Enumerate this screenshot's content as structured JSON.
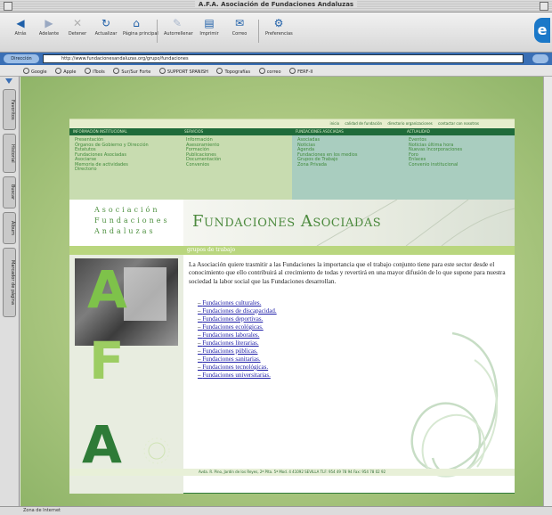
{
  "window": {
    "title": "A.F.A. Asociación de Fundaciones Andaluzas"
  },
  "toolbar": {
    "buttons": [
      {
        "label": "Atrás",
        "icon": "back-arrow-icon"
      },
      {
        "label": "Adelante",
        "icon": "forward-arrow-icon"
      },
      {
        "label": "Detener",
        "icon": "stop-icon"
      },
      {
        "label": "Actualizar",
        "icon": "refresh-icon"
      },
      {
        "label": "Página principal",
        "icon": "home-icon"
      },
      {
        "label": "Autorrellenar",
        "icon": "pencil-icon"
      },
      {
        "label": "Imprimir",
        "icon": "printer-icon"
      },
      {
        "label": "Correo",
        "icon": "mail-icon"
      },
      {
        "label": "Preferencias",
        "icon": "gear-icon"
      }
    ]
  },
  "address": {
    "label": "Dirección",
    "url": "http://www.fundacionesandaluzas.org/grupo/fundaciones"
  },
  "favorites": [
    "Google",
    "Apple",
    "iTools",
    "Sur/Sur Forte",
    "SUPPORT SPANISH",
    "Topografías",
    "correo",
    "FERF-II"
  ],
  "sidebar_tabs": [
    "Favoritos",
    "Historial",
    "Buscar",
    "Álbum",
    "Marcador de página"
  ],
  "status": {
    "text": "Zona de Internet"
  },
  "site": {
    "top_links": [
      "inicio",
      "calidad de fundación",
      "directorio organizaciones",
      "contactar con nosotros"
    ],
    "menu": [
      {
        "heading": "INFORMACIÓN INSTITUCIONAL",
        "items": [
          "Presentación",
          "Órganos de Gobierno y Dirección",
          "Estatutos",
          "Fundaciones Asociadas",
          "Asociarse",
          "Memoria de actividades",
          "Directorio"
        ]
      },
      {
        "heading": "SERVICIOS",
        "items": [
          "Información",
          "Asesoramiento",
          "Formación",
          "Publicaciones",
          "Documentación",
          "Convenios"
        ]
      },
      {
        "heading": "FUNDACIONES ASOCIADAS",
        "items": [
          "Asociadas",
          "Noticias",
          "Agenda",
          "Fundaciones en los medios",
          "Grupos de Trabajo",
          "Zona Privada"
        ]
      },
      {
        "heading": "ACTUALIDAD",
        "items": [
          "Eventos",
          "Noticias última hora",
          "Nuevas Incorporaciones",
          "Foro",
          "Enlaces",
          "Convenio institucional"
        ]
      }
    ],
    "logo": [
      "Asociación",
      "Fundaciones",
      "Andaluzas"
    ],
    "banner_title": "Fundaciones Asociadas",
    "section_label": "grupos de trabajo",
    "photo_letters": [
      "A",
      "F",
      "A"
    ],
    "intro": "La Asociación quiere trasmitir a las Fundaciones la importancia que el trabajo conjunto tiene para este sector desde el conocimiento que ello contribuirá al crecimiento de todas y revertirá en una mayor difusión de lo que supone para nuestra sociedad la labor social que las Fundaciones desarrollan.",
    "links": [
      "Fundaciones culturales.",
      "Fundaciones de discapacidad.",
      "Fundaciones deportivas.",
      "Fundaciones ecológicas.",
      "Fundaciones laborales.",
      "Fundaciones literarias.",
      "Fundaciones públicas.",
      "Fundaciones sanitarias.",
      "Fundaciones tecnológicas.",
      "Fundaciones universitarias."
    ],
    "footer": "Avda. R. Pino, Jardín de los Reyes, 2ª Plta. 5ª Mod. 4 41092 SEVILLA   TLF: 954 49 78 94   Fax: 954 78 02 92"
  },
  "colors": {
    "site_green": "#4c8a3e",
    "menu_dark": "#1f6b3a",
    "background": "#b4cd88",
    "link": "#1a1aa6"
  }
}
